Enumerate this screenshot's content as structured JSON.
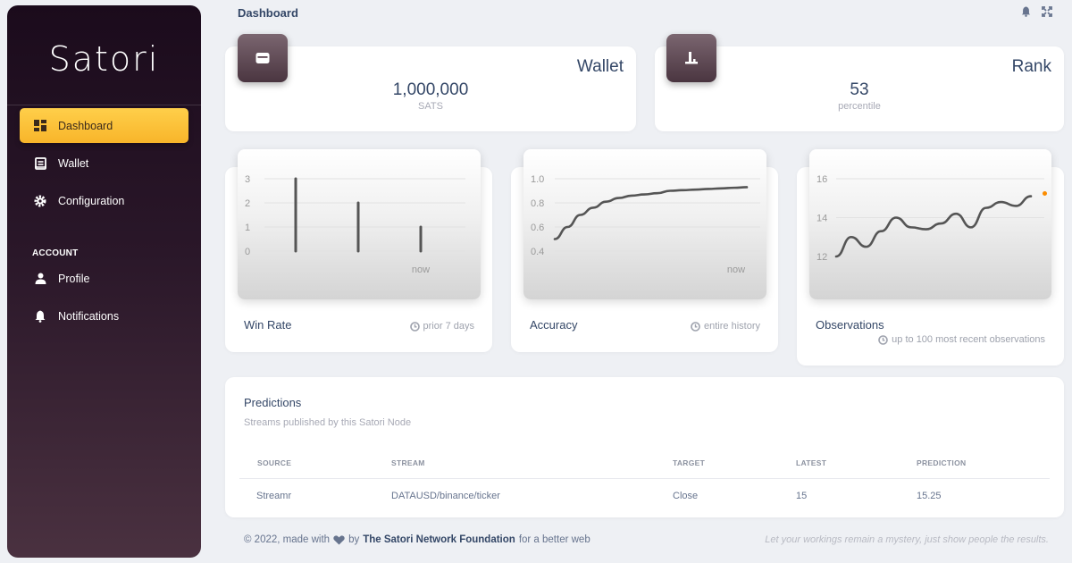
{
  "brand": {
    "name": "Satori"
  },
  "sidebar": {
    "items": [
      {
        "label": "Dashboard",
        "icon": "dashboard-icon"
      },
      {
        "label": "Wallet",
        "icon": "wallet-icon"
      },
      {
        "label": "Configuration",
        "icon": "gear-icon"
      }
    ],
    "account_label": "ACCOUNT",
    "account_items": [
      {
        "label": "Profile",
        "icon": "user-icon"
      },
      {
        "label": "Notifications",
        "icon": "bell-icon"
      }
    ]
  },
  "header": {
    "title": "Dashboard",
    "icons": [
      "bell-icon",
      "fullscreen-icon"
    ]
  },
  "stats": {
    "wallet": {
      "title": "Wallet",
      "value": "1,000,000",
      "unit": "SATS",
      "icon": "wallet-card-icon"
    },
    "rank": {
      "title": "Rank",
      "value": "53",
      "unit": "percentile",
      "icon": "podium-icon"
    }
  },
  "charts": {
    "win_rate": {
      "title": "Win Rate",
      "note": "prior 7 days"
    },
    "accuracy": {
      "title": "Accuracy",
      "note": "entire history"
    },
    "observations": {
      "title": "Observations",
      "note": "up to 100 most recent observations"
    }
  },
  "chart_data": [
    {
      "type": "bar",
      "title": "Win Rate",
      "xlabel": "",
      "ylabel": "",
      "categories": [
        "",
        "",
        "now"
      ],
      "values": [
        3,
        2,
        1
      ],
      "ylim": [
        0,
        3
      ],
      "yticks": [
        "0",
        "1",
        "2",
        "3"
      ],
      "color": "#555555"
    },
    {
      "type": "line",
      "title": "Accuracy",
      "xlabel": "",
      "ylabel": "",
      "x_last_label": "now",
      "values": [
        0.5,
        0.6,
        0.7,
        0.76,
        0.81,
        0.84,
        0.86,
        0.87,
        0.88,
        0.9,
        0.905,
        0.91,
        0.915,
        0.92,
        0.925,
        0.93
      ],
      "ylim": [
        0.4,
        1.0
      ],
      "yticks": [
        "0.4",
        "0.6",
        "0.8",
        "1.0"
      ],
      "color": "#555555"
    },
    {
      "type": "line",
      "title": "Observations",
      "xlabel": "",
      "ylabel": "",
      "values": [
        12,
        13,
        12.5,
        13.3,
        14,
        13.5,
        13.4,
        13.7,
        14.2,
        13.5,
        14.5,
        14.8,
        14.6,
        15.1
      ],
      "ylim": [
        12,
        16
      ],
      "yticks": [
        "12",
        "14",
        "16"
      ],
      "color": "#555555",
      "marker_color": "#fb8c00"
    }
  ],
  "predictions": {
    "title": "Predictions",
    "subtitle": "Streams published by this Satori Node",
    "columns": [
      "SOURCE",
      "STREAM",
      "TARGET",
      "LATEST",
      "PREDICTION"
    ],
    "rows": [
      {
        "source": "Streamr",
        "stream": "DATAUSD/binance/ticker",
        "target": "Close",
        "latest": "15",
        "prediction": "15.25"
      }
    ]
  },
  "footer": {
    "prefix": "© 2022, made with",
    "by": "by",
    "org": "The Satori Network Foundation",
    "suffix": "for a better web",
    "quote": "Let your workings remain a mystery, just show people the results."
  }
}
